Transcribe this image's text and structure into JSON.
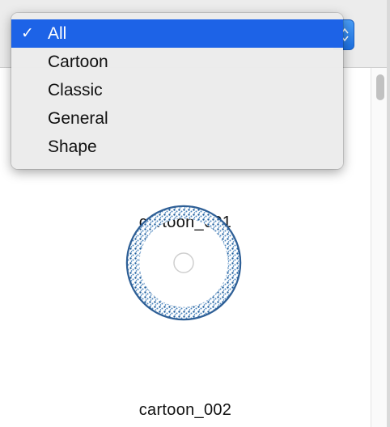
{
  "popup": {
    "selected": "All",
    "items": [
      {
        "label": "All",
        "checked": true
      },
      {
        "label": "Cartoon",
        "checked": false
      },
      {
        "label": "Classic",
        "checked": false
      },
      {
        "label": "General",
        "checked": false
      },
      {
        "label": "Shape",
        "checked": false
      }
    ],
    "check_glyph": "✓",
    "stepper_glyph": "⇳"
  },
  "gallery": {
    "items": [
      {
        "label": "cartoon_001",
        "icon": "blank-preview"
      },
      {
        "label": "cartoon_002",
        "icon": "speckled-blue-ring-preview"
      }
    ]
  },
  "colors": {
    "selection": "#1d63e7",
    "ring": "#2a6fb3"
  }
}
